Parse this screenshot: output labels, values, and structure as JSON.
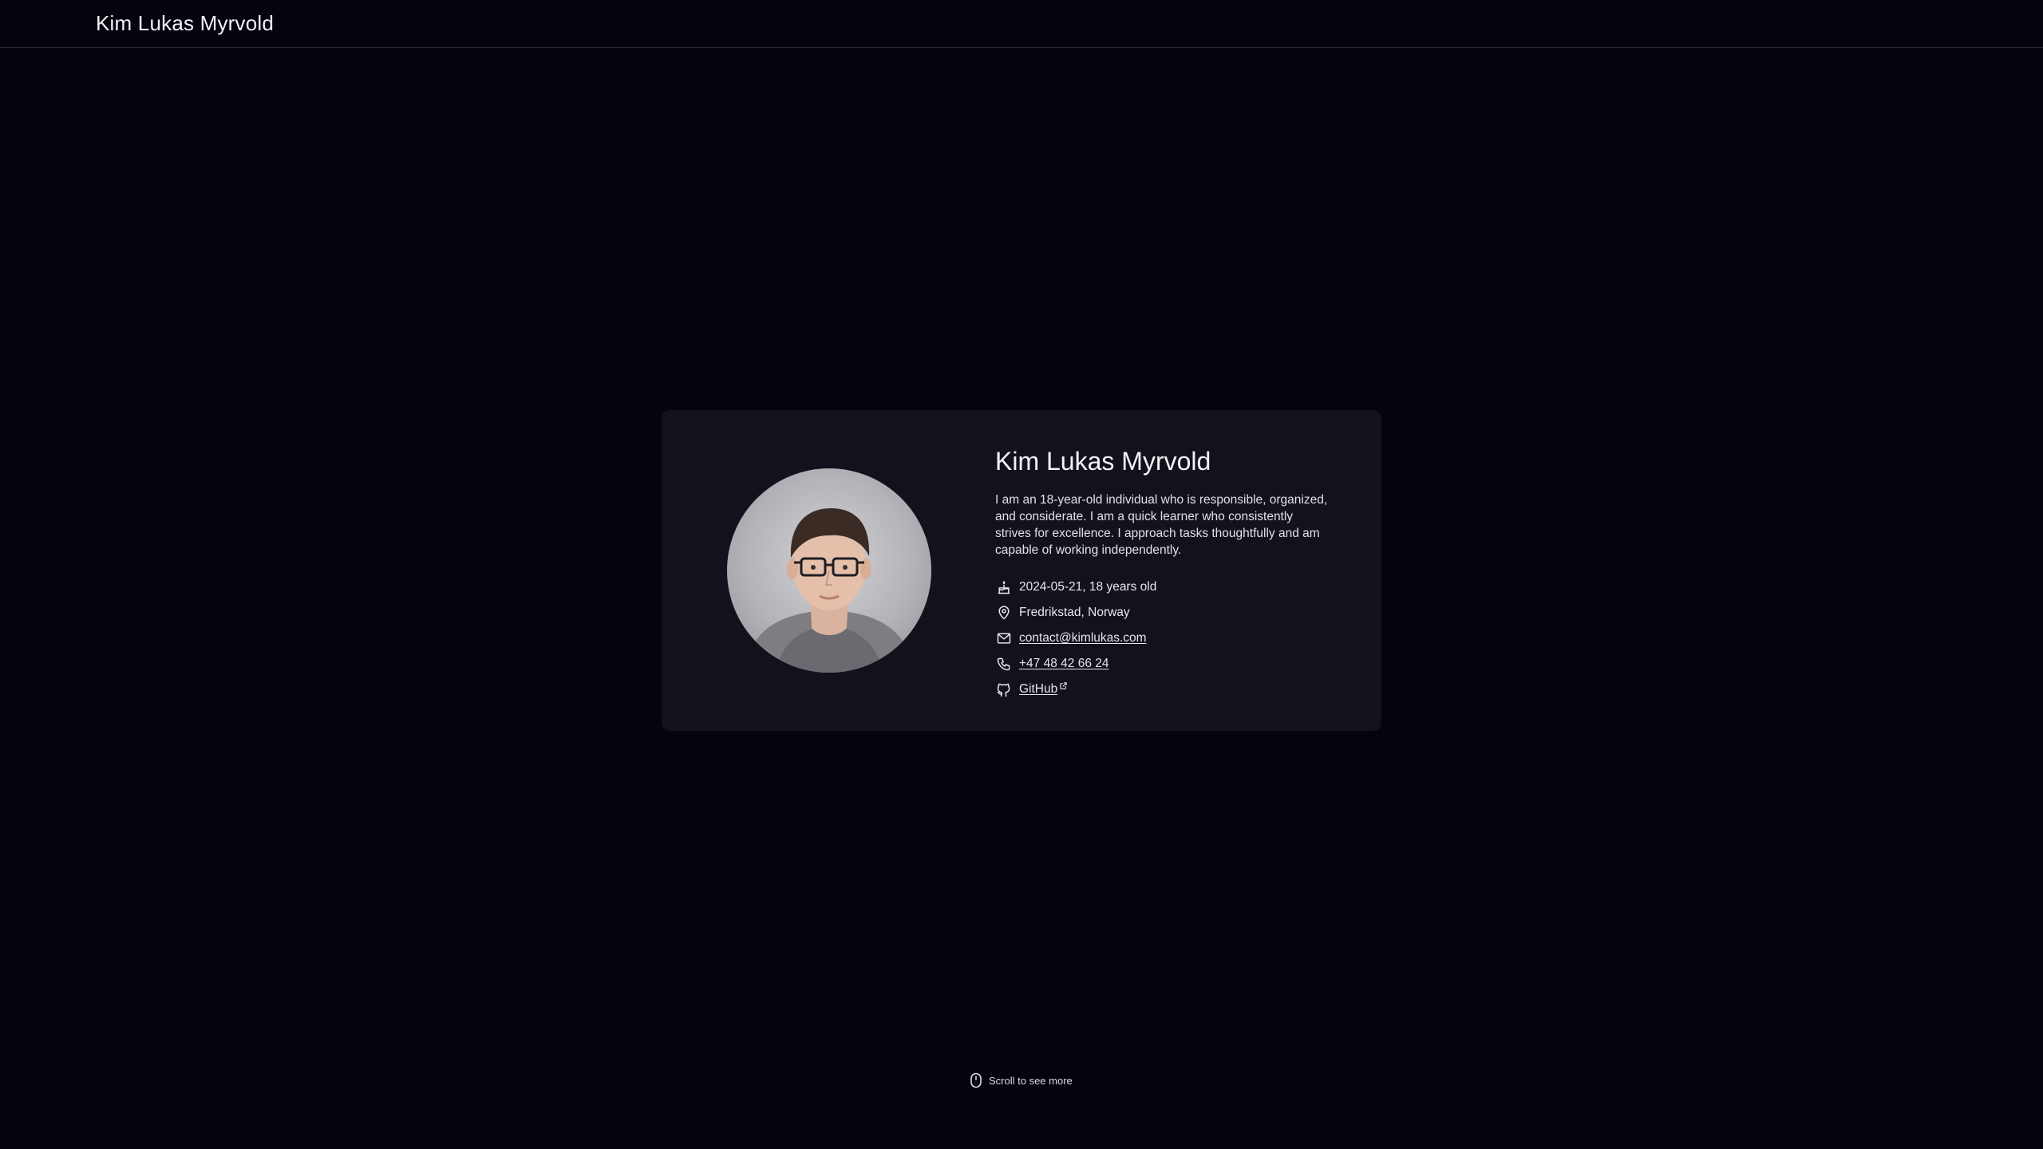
{
  "header": {
    "brand": "Kim Lukas Myrvold"
  },
  "profile": {
    "name": "Kim Lukas Myrvold",
    "bio": "I am an 18-year-old individual who is responsible, organized, and considerate. I am a quick learner who consistently strives for excellence. I approach tasks thoughtfully and am capable of working independently.",
    "details": [
      {
        "icon": "cake-icon",
        "text": "2024-05-21, 18 years old"
      },
      {
        "icon": "map-pin-icon",
        "text": "Fredrikstad, Norway"
      },
      {
        "icon": "mail-icon",
        "text": "contact@kimlukas.com"
      },
      {
        "icon": "phone-icon",
        "text": "+47 48 42 66 24"
      },
      {
        "icon": "github-icon",
        "text": "GitHub"
      }
    ]
  },
  "footer": {
    "scroll_hint": "Scroll to see more",
    "icon": "mouse-icon"
  },
  "colors": {
    "background": "#04040f",
    "card": "#12121d",
    "text": "#e6e6ec",
    "divider": "#2a2a35"
  }
}
